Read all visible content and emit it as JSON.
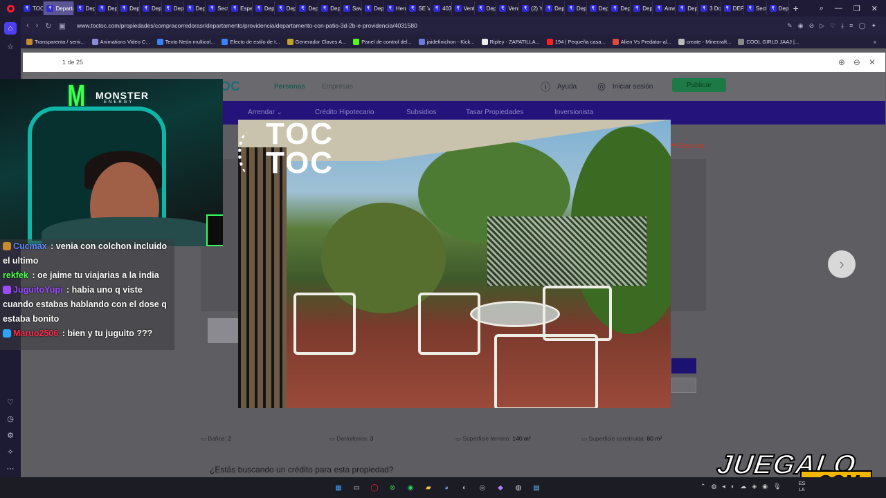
{
  "browser": {
    "tabs": [
      {
        "label": "TOC",
        "active": false
      },
      {
        "label": "Departa",
        "active": true
      },
      {
        "label": "Dep"
      },
      {
        "label": "Dep"
      },
      {
        "label": "Dep"
      },
      {
        "label": "Dep"
      },
      {
        "label": "Dep"
      },
      {
        "label": "Dep"
      },
      {
        "label": "Sect"
      },
      {
        "label": "Espe"
      },
      {
        "label": "Dep"
      },
      {
        "label": "Dep"
      },
      {
        "label": "Dep"
      },
      {
        "label": "Dep"
      },
      {
        "label": "Sav"
      },
      {
        "label": "Dep"
      },
      {
        "label": "Herr"
      },
      {
        "label": "SE V"
      },
      {
        "label": "403"
      },
      {
        "label": "Vent"
      },
      {
        "label": "Dep"
      },
      {
        "label": "Vent"
      },
      {
        "label": "(2) Y"
      },
      {
        "label": "Dep"
      },
      {
        "label": "Dep"
      },
      {
        "label": "Dep"
      },
      {
        "label": "Dep"
      },
      {
        "label": "Dep"
      },
      {
        "label": "Ame"
      },
      {
        "label": "Dep"
      },
      {
        "label": "3 Do"
      },
      {
        "label": "DEP"
      },
      {
        "label": "Sect"
      },
      {
        "label": "Dep"
      }
    ],
    "url": "www.toctoc.com/propiedades/compracorredorasr/departamento/providencia/departamento-con-patio-3d-2b-e-providencia/4031580",
    "bookmarks": [
      {
        "label": "Transparenta / semi...",
        "color": "#c98a2b"
      },
      {
        "label": "Animations Video C...",
        "color": "#8b8bd6"
      },
      {
        "label": "Texto Neón multicol...",
        "color": "#3b82f6"
      },
      {
        "label": "Efecto de estilo de t...",
        "color": "#3b82f6"
      },
      {
        "label": "Generador Claves A...",
        "color": "#c4a12a"
      },
      {
        "label": "Panel de control del...",
        "color": "#53fc18"
      },
      {
        "label": "jaidefinichon - Kick...",
        "color": "#6b7be0"
      },
      {
        "label": "Ripley - ZAPATILLA...",
        "color": "#eeeeee"
      },
      {
        "label": "194 | Pequeña casa...",
        "color": "#ff2020"
      },
      {
        "label": "Alien Vs Predator-al...",
        "color": "#e04a3a"
      },
      {
        "label": "create - Minecraft...",
        "color": "#bbbbbb"
      },
      {
        "label": "COOL GIRLD JAAJ |...",
        "color": "#8a8a8a"
      }
    ]
  },
  "gallery": {
    "counter": "1 de 25"
  },
  "site": {
    "logo": "TOCTOC",
    "nav": {
      "personas": "Personas",
      "empresas": "Empresas",
      "ayuda": "Ayuda",
      "login": "Iniciar sesión",
      "publicar": "Publicar"
    },
    "menu": [
      "Arrendar ⌄",
      "Crédito Hipotecario",
      "Subsidios",
      "Tasar Propiedades",
      "Inversionista"
    ],
    "report": "Reportar",
    "features": [
      {
        "label": "Baños:",
        "value": "2"
      },
      {
        "label": "Dormitorios:",
        "value": "3"
      },
      {
        "label": "Superficie terreno:",
        "value": "140 m²"
      },
      {
        "label": "Superficie construida:",
        "value": "80 m²"
      }
    ],
    "credit_question": "¿Estás buscando un crédito para esta propiedad?",
    "photo_watermark": [
      "TOC",
      "TOC"
    ]
  },
  "stream": {
    "sponsor": {
      "brand": "MONSTER",
      "tagline": "ENERGY"
    },
    "chat": [
      {
        "user": "Cucmax",
        "text": "venia con colchon incluido el ultimo",
        "user_color": "#5b8cff",
        "icon_color": "#c98a2b"
      },
      {
        "user": "rekfek",
        "text": "oe jaime tu viajarias a la india",
        "user_color": "#4cff4c",
        "icon_color": ""
      },
      {
        "user": "JuguitoYupi",
        "text": "habia uno q viste cuando estabas hablando con el dose q estaba bonito",
        "user_color": "#9b4bff",
        "icon_color": "#9b4bff"
      },
      {
        "user": "Maruo2506",
        "text": "bien y tu juguito ???",
        "user_color": "#ff2b4a",
        "icon_color": "#2aa5ff"
      }
    ],
    "watermark": {
      "top": "JUEGALO",
      "bottom": ".COM"
    }
  },
  "taskbar": {
    "lang": "ES\nLA"
  }
}
